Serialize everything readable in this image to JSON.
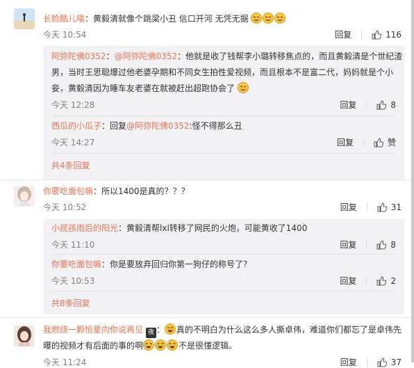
{
  "comments": [
    {
      "user": "长脸酷儿嘻",
      "text": "：黄毅清就像个跳梁小丑 信口开河 无凭无据",
      "time": "今天 10:54",
      "reply_label": "回复",
      "likes": "116",
      "emojis": [
        "smirk-emoji",
        "smirk-emoji",
        "smirk-emoji"
      ],
      "replies": [
        {
          "user": "阿弥陀佛0352",
          "prefix": "：",
          "mention": "@阿弥陀佛0352",
          "text_line1": "：他就是收了钱帮李小璐转移焦点的，而且黄毅清是个世纪渣",
          "text_line2": "男，当时王思聪爆过他老婆孕期和不同女生拍性爱视频，而且根本不是富二代，妈妈就是个小",
          "text_line3": "妾，黄毅清因为睡车友老婆在就被赶出超跑协会了",
          "time": "今天 12:28",
          "reply_label": "回复",
          "likes": "8"
        },
        {
          "user": "西瓜的小瓜子",
          "prefix": "：回复",
          "mention": "@阿弥陀佛0352",
          "text_line1": ":怪不得那么丑",
          "time": "今天 14:27",
          "reply_label": "回复",
          "likes": "赞"
        }
      ],
      "more": "共4条回复"
    },
    {
      "user": "你要吃面包嘛",
      "text": "：所以1400是真的？？？",
      "time": "今天 10:52",
      "reply_label": "回复",
      "likes": "31",
      "replies": [
        {
          "user": "小屁孩雨后的阳光",
          "text_line1": "：黄毅清帮lxl转移了网民的火炮，可能黄收了1400",
          "time": "今天 11:10",
          "reply_label": "回复",
          "likes": "8"
        },
        {
          "user": "你要吃面包嘛",
          "text_line1": "：你是要放弃回归你第一狗仔的称号了？",
          "time": "今天 10:53",
          "reply_label": "回复",
          "likes": "2"
        }
      ],
      "more": "共8条回复"
    },
    {
      "user": "我燃烧一颗恒星向你说再见",
      "badge": "夜",
      "text_line1": "真的不明白为什么这么多人撕卓伟，难道你们都忘了是卓伟先",
      "text_line2": "曝的视频才有后面的事的啊",
      "text_line2_tail": "不是很懂逻辑。",
      "time": "今天 11:24",
      "reply_label": "回复",
      "likes": "37"
    }
  ],
  "colors": {
    "accent": "#eb7350",
    "reply_bg": "#f2f2f5",
    "muted": "#808080"
  }
}
